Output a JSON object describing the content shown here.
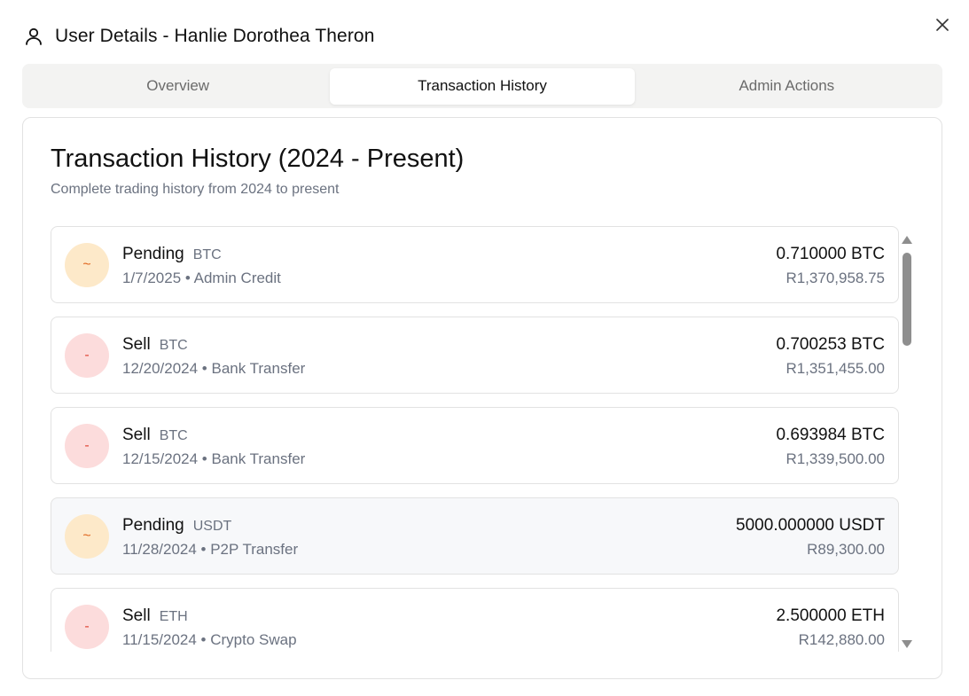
{
  "dialog": {
    "title": "User Details - Hanlie Dorothea Theron",
    "icons": {
      "user": "user-icon",
      "close": "close-icon"
    }
  },
  "tabs": [
    {
      "label": "Overview",
      "active": false
    },
    {
      "label": "Transaction History",
      "active": true
    },
    {
      "label": "Admin Actions",
      "active": false
    }
  ],
  "panel": {
    "title": "Transaction History (2024 - Present)",
    "subtitle": "Complete trading history from 2024 to present"
  },
  "transactions": [
    {
      "icon": "~",
      "status": "pending",
      "type": "Pending",
      "asset": "BTC",
      "meta": "1/7/2025 • Admin Credit",
      "amount": "0.710000 BTC",
      "fiat": "R1,370,958.75"
    },
    {
      "icon": "-",
      "status": "sell",
      "type": "Sell",
      "asset": "BTC",
      "meta": "12/20/2024 • Bank Transfer",
      "amount": "0.700253 BTC",
      "fiat": "R1,351,455.00"
    },
    {
      "icon": "-",
      "status": "sell",
      "type": "Sell",
      "asset": "BTC",
      "meta": "12/15/2024 • Bank Transfer",
      "amount": "0.693984 BTC",
      "fiat": "R1,339,500.00"
    },
    {
      "icon": "~",
      "status": "pending",
      "type": "Pending",
      "asset": "USDT",
      "meta": "11/28/2024 • P2P Transfer",
      "amount": "5000.000000 USDT",
      "fiat": "R89,300.00"
    },
    {
      "icon": "-",
      "status": "sell",
      "type": "Sell",
      "asset": "ETH",
      "meta": "11/15/2024 • Crypto Swap",
      "amount": "2.500000 ETH",
      "fiat": "R142,880.00"
    }
  ],
  "colors": {
    "pending_bg": "#fde9c9",
    "pending_fg": "#e0661e",
    "sell_bg": "#fcdcdc",
    "sell_fg": "#e04a3a",
    "muted_text": "#6b7280"
  }
}
